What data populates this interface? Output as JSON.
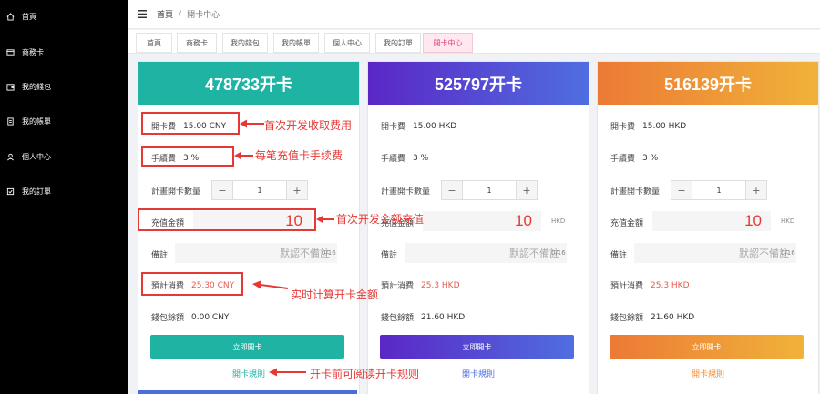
{
  "sidebar": {
    "items": [
      {
        "label": "首頁",
        "icon": "home-icon"
      },
      {
        "label": "商務卡",
        "icon": "card-icon"
      },
      {
        "label": "我的錢包",
        "icon": "wallet-icon"
      },
      {
        "label": "我的帳單",
        "icon": "bill-icon"
      },
      {
        "label": "個人中心",
        "icon": "user-icon"
      },
      {
        "label": "我的訂單",
        "icon": "order-icon"
      }
    ]
  },
  "header": {
    "breadcrumb_home": "首頁",
    "breadcrumb_sep": "/",
    "breadcrumb_current": "開卡中心"
  },
  "tabs": [
    {
      "label": "首頁",
      "active": false
    },
    {
      "label": "商務卡",
      "active": false
    },
    {
      "label": "我的錢包",
      "active": false
    },
    {
      "label": "我的帳單",
      "active": false
    },
    {
      "label": "個人中心",
      "active": false
    },
    {
      "label": "我的訂單",
      "active": false
    },
    {
      "label": "開卡中心",
      "active": true
    }
  ],
  "cards": [
    {
      "title": "478733开卡",
      "fee_label": "開卡費",
      "fee_value": "15.00 CNY",
      "handling_label": "手續費",
      "handling_value": "3 %",
      "qty_label": "計畫開卡數量",
      "qty_minus": "−",
      "qty_value": "1",
      "qty_plus": "+",
      "recharge_label": "充值金額",
      "recharge_value": "10",
      "recharge_unit": "",
      "note_label": "備註",
      "note_placeholder": "默認不備註",
      "note_count": "0/16",
      "estimate_label": "預計消費",
      "estimate_value": "25.30 CNY",
      "balance_label": "錢包餘額",
      "balance_value": "0.00 CNY",
      "open_button": "立即開卡",
      "rules_link": "開卡規則",
      "accent_color": "#1fb3a4"
    },
    {
      "title": "525797开卡",
      "fee_label": "開卡費",
      "fee_value": "15.00 HKD",
      "handling_label": "手續費",
      "handling_value": "3 %",
      "qty_label": "計畫開卡數量",
      "qty_minus": "−",
      "qty_value": "1",
      "qty_plus": "+",
      "recharge_label": "充值金額",
      "recharge_value": "10",
      "recharge_unit": "HKD",
      "note_label": "備註",
      "note_placeholder": "默認不備註",
      "note_count": "0/16",
      "estimate_label": "預計消費",
      "estimate_value": "25.3 HKD",
      "balance_label": "錢包餘額",
      "balance_value": "21.60 HKD",
      "open_button": "立即開卡",
      "rules_link": "開卡規則",
      "accent_color": "#5b3fcf"
    },
    {
      "title": "516139开卡",
      "fee_label": "開卡費",
      "fee_value": "15.00 HKD",
      "handling_label": "手續費",
      "handling_value": "3 %",
      "qty_label": "計畫開卡數量",
      "qty_minus": "−",
      "qty_value": "1",
      "qty_plus": "+",
      "recharge_label": "充值金額",
      "recharge_value": "10",
      "recharge_unit": "HKD",
      "note_label": "備註",
      "note_placeholder": "默認不備註",
      "note_count": "0/16",
      "estimate_label": "預計消費",
      "estimate_value": "25.3 HKD",
      "balance_label": "錢包餘額",
      "balance_value": "21.60 HKD",
      "open_button": "立即開卡",
      "rules_link": "開卡規則",
      "accent_color": "#f08c35"
    }
  ],
  "annotations": [
    "首次开发收取费用",
    "每笔充值卡手续费",
    "首次开发金额充值",
    "实时计算开卡金额",
    "开卡前可阅读开卡规则"
  ],
  "colors": {
    "annotation_red": "#e53935",
    "sidebar_bg": "#000000",
    "active_tab": "#e0417d"
  }
}
